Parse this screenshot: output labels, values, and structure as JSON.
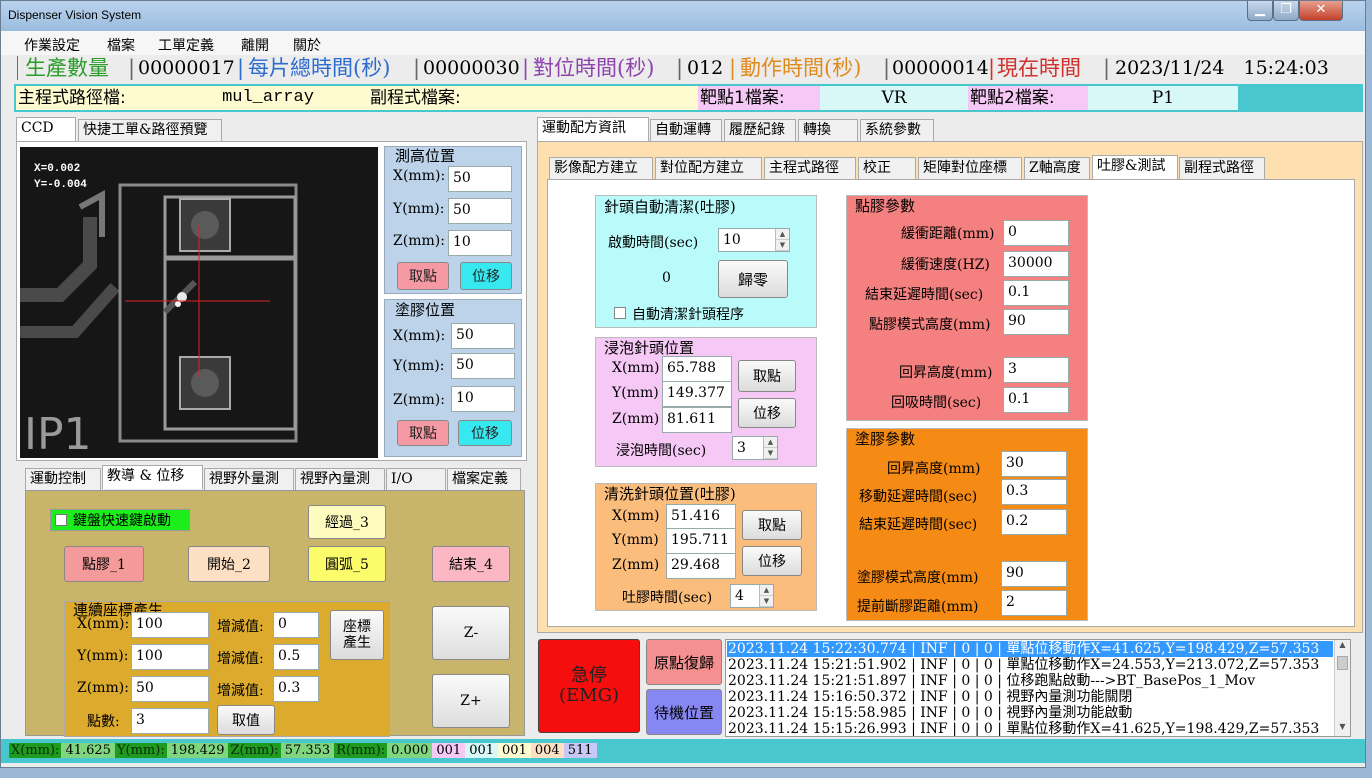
{
  "window": {
    "title": "Dispenser Vision System"
  },
  "menu": [
    "作業設定",
    "檔案",
    "工單定義",
    "離開",
    "關於"
  ],
  "stats": {
    "prod_label": "生產數量",
    "prod_value": "00000017",
    "total_label": "每片總時間(秒)",
    "total_value": "00000030",
    "align_label": "對位時間(秒)",
    "align_value": "012",
    "action_label": "動作時間(秒)",
    "action_value": "00000014",
    "now_label": "現在時間",
    "now_value": "2023/11/24　15:24:03"
  },
  "paths": {
    "main_label": "主程式路徑檔:",
    "main_value": "mul_array",
    "sub_label": "副程式檔案:",
    "sub_value": "",
    "t1_label": "靶點1檔案:",
    "t1_value": "VR",
    "t2_label": "靶點2檔案:",
    "t2_value": "P1"
  },
  "left_tabs": [
    "CCD",
    "快捷工單&路徑預覽"
  ],
  "camera": {
    "x_text": "X=0.002",
    "y_text": "Y=-0.004",
    "label_text": "IP1"
  },
  "height_pos": {
    "title": "測高位置",
    "x_label": "X(mm):",
    "x": "50",
    "y_label": "Y(mm):",
    "y": "50",
    "z_label": "Z(mm):",
    "z": "10",
    "pick": "取點",
    "move": "位移"
  },
  "glue_pos": {
    "title": "塗膠位置",
    "x_label": "X(mm):",
    "x": "50",
    "y_label": "Y(mm):",
    "y": "50",
    "z_label": "Z(mm):",
    "z": "10",
    "pick": "取點",
    "move": "位移"
  },
  "lower_tabs": [
    "運動控制",
    "教導 & 位移",
    "視野外量測",
    "視野內量測",
    "I/O",
    "檔案定義"
  ],
  "teach": {
    "kb_label": "鍵盤快速鍵啟動",
    "pass": "經過_3",
    "dot": "點膠_1",
    "start": "開始_2",
    "arc": "圓弧_5",
    "end": "結束_4",
    "zminus": "Z-",
    "zplus": "Z+"
  },
  "coord_gen": {
    "title": "連續座標產生",
    "x_label": "X(mm):",
    "x": "100",
    "y_label": "Y(mm):",
    "y": "100",
    "z_label": "Z(mm):",
    "z": "50",
    "n_label": "點數:",
    "n": "3",
    "dx_label": "增減值:",
    "dx": "0",
    "dy_label": "增減值:",
    "dy": "0.5",
    "dz_label": "增減值:",
    "dz": "0.3",
    "gen": "座標\n產生",
    "take": "取值"
  },
  "right_tabs": [
    "運動配方資訊",
    "自動運轉",
    "履歷紀錄",
    "轉換",
    "系統參數"
  ],
  "sub_tabs": [
    "影像配方建立",
    "對位配方建立",
    "主程式路徑",
    "校正",
    "矩陣對位座標",
    "Z軸高度",
    "吐膠&測試",
    "副程式路徑"
  ],
  "clean": {
    "title": "針頭自動清潔(吐膠)",
    "start_label": "啟動時間(sec)",
    "start": "10",
    "count": "0",
    "zero": "歸零",
    "auto_label": "自動清潔針頭程序"
  },
  "soak": {
    "title": "浸泡針頭位置",
    "x_label": "X(mm)",
    "x": "65.788",
    "y_label": "Y(mm)",
    "y": "149.377",
    "z_label": "Z(mm)",
    "z": "81.611",
    "time_label": "浸泡時間(sec)",
    "time": "3",
    "pick": "取點",
    "move": "位移"
  },
  "wash": {
    "title": "清洗針頭位置(吐膠)",
    "x_label": "X(mm)",
    "x": "51.416",
    "y_label": "Y(mm)",
    "y": "195.711",
    "z_label": "Z(mm)",
    "z": "29.468",
    "time_label": "吐膠時間(sec)",
    "time": "4",
    "pick": "取點",
    "move": "位移"
  },
  "dot_params": {
    "title": "點膠參數",
    "buf_dist_label": "緩衝距離(mm)",
    "buf_dist": "0",
    "buf_speed_label": "緩衝速度(HZ)",
    "buf_speed": "30000",
    "end_delay_label": "結束延遲時間(sec)",
    "end_delay": "0.1",
    "mode_h_label": "點膠模式高度(mm)",
    "mode_h": "90",
    "rise_label": "回昇高度(mm)",
    "rise": "3",
    "suck_label": "回吸時間(sec)",
    "suck": "0.1"
  },
  "coat_params": {
    "title": "塗膠參數",
    "rise_label": "回昇高度(mm)",
    "rise": "30",
    "move_delay_label": "移動延遲時間(sec)",
    "move_delay": "0.3",
    "end_delay_label": "結束延遲時間(sec)",
    "end_delay": "0.2",
    "mode_h_label": "塗膠模式高度(mm)",
    "mode_h": "90",
    "cut_label": "提前斷膠距離(mm)",
    "cut": "2"
  },
  "control": {
    "emg": "急停\n(EMG)",
    "home": "原點復歸",
    "standby": "待機位置"
  },
  "log": [
    "2023.11.24 15:22:30.774 | INF | 0 | 0 | 單點位移動作X=41.625,Y=198.429,Z=57.353",
    "2023.11.24 15:21:51.902 | INF | 0 | 0 | 單點位移動作X=24.553,Y=213.072,Z=57.353",
    "2023.11.24 15:21:51.897 | INF | 0 | 0 | 位移跑點啟動--->BT_BasePos_1_Mov",
    "2023.11.24 15:16:50.372 | INF | 0 | 0 | 視野內量測功能關閉",
    "2023.11.24 15:15:58.985 | INF | 0 | 0 | 視野內量測功能啟動",
    "2023.11.24 15:15:26.993 | INF | 0 | 0 | 單點位移動作X=41.625,Y=198.429,Z=57.353"
  ],
  "statusbar": {
    "x_label": "X(mm):",
    "x": "41.625",
    "y_label": "Y(mm):",
    "y": "198.429",
    "z_label": "Z(mm):",
    "z": "57.353",
    "r_label": "R(mm):",
    "r": "0.000",
    "c1": "001",
    "c2": "001",
    "c3": "001",
    "c4": "004",
    "c5": "511"
  }
}
